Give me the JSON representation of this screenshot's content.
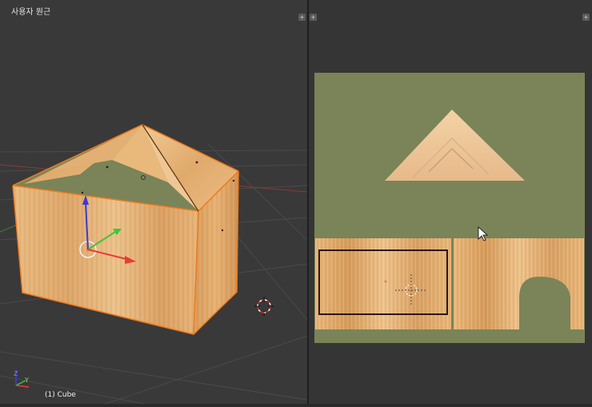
{
  "viewport": {
    "label": "사용자 원근",
    "object_label": "(1) Cube",
    "axis_x_label": "X",
    "axis_y_label": "Y",
    "axis_z_label": "Z"
  },
  "colors": {
    "background": "#393939",
    "uv_background": "#353535",
    "uv_green": "#7a8458",
    "wood_light": "#e8b77a",
    "wood_dark": "#c88d4e",
    "outline_orange": "#f07a1e",
    "axis_red": "#e83a3a",
    "axis_green": "#3ac83a",
    "axis_blue": "#3a3ad8"
  },
  "icons": {
    "area_corner": "plus-corner-icon",
    "cursor": "3d-cursor-icon",
    "pointer": "mouse-pointer-icon"
  }
}
